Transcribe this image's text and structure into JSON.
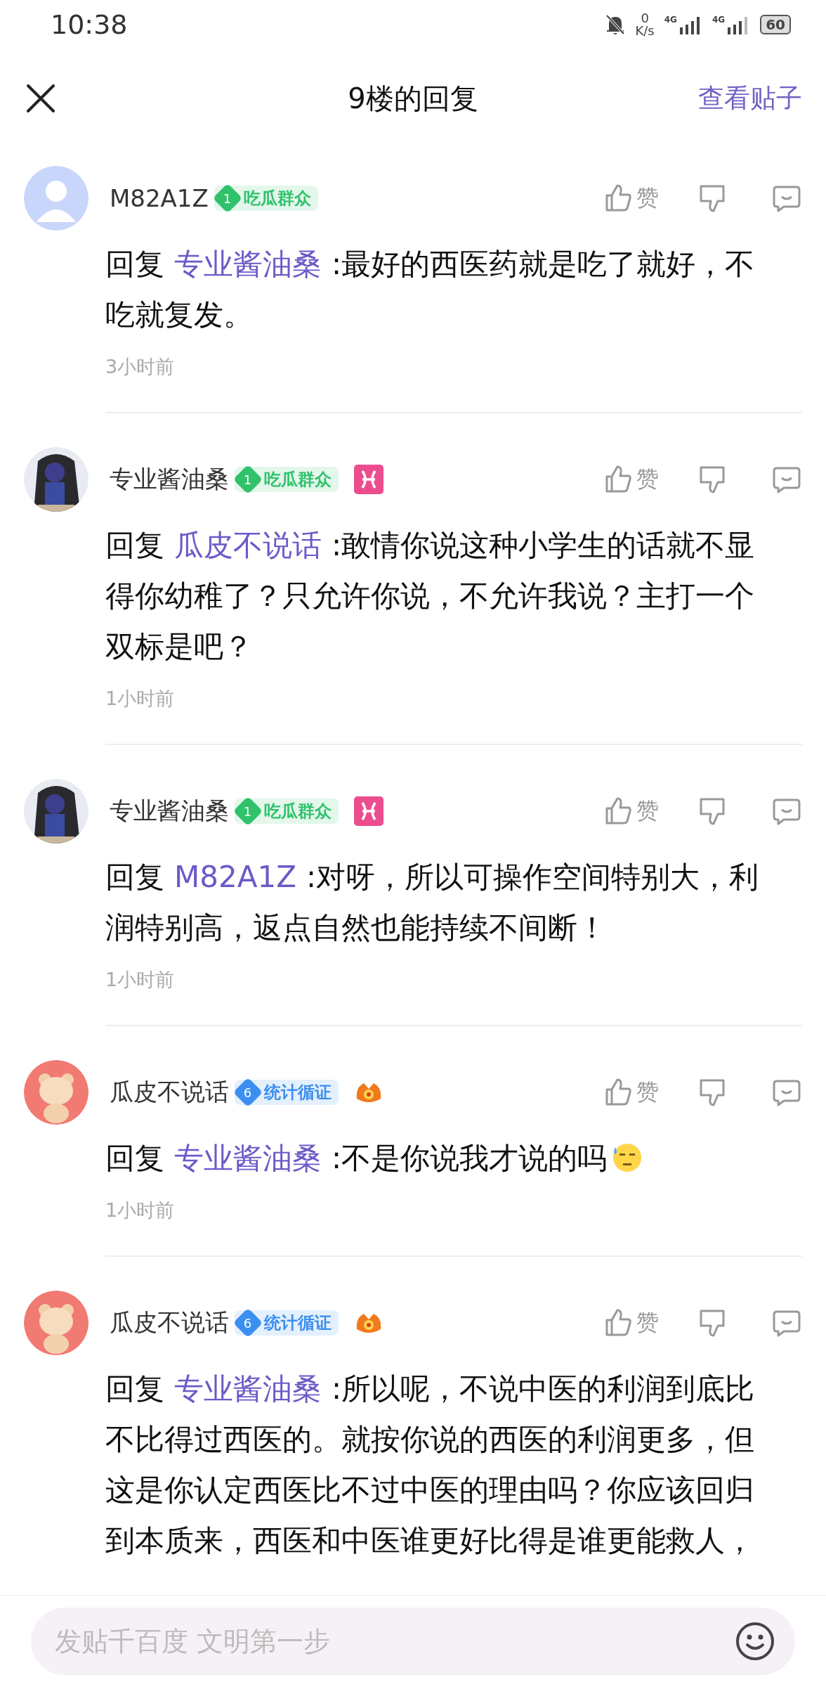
{
  "status_bar": {
    "time": "10:38",
    "net_speed_value": "0",
    "net_speed_unit": "K/s",
    "sim_1": "4G",
    "sim_2": "4G",
    "battery": "60"
  },
  "header": {
    "title": "9楼的回复",
    "action": "查看贴子"
  },
  "comments": [
    {
      "avatar": {
        "kind": "default"
      },
      "name": "M82A1Z",
      "level": "1",
      "badge": "吃瓜群众",
      "color": "#2fc26b",
      "like": "赞",
      "prefix": "回复",
      "reply_to": "专业酱油桑",
      "text": ":最好的西医药就是吃了就好，不吃就复发。",
      "emoji": false,
      "time": "3小时前"
    },
    {
      "avatar": {
        "kind": "anime"
      },
      "name": "专业酱油桑",
      "level": "1",
      "badge": "吃瓜群众",
      "color": "#2fc26b",
      "extra": {
        "kind": "zodiac"
      },
      "like": "赞",
      "prefix": "回复",
      "reply_to": "瓜皮不说话",
      "text": ":敢情你说这种小学生的话就不显得你幼稚了？只允许你说，不允许我说？主打一个双标是吧？",
      "emoji": false,
      "time": "1小时前"
    },
    {
      "avatar": {
        "kind": "anime"
      },
      "name": "专业酱油桑",
      "level": "1",
      "badge": "吃瓜群众",
      "color": "#2fc26b",
      "extra": {
        "kind": "zodiac"
      },
      "like": "赞",
      "prefix": "回复",
      "reply_to": "M82A1Z",
      "text": ":对呀，所以可操作空间特别大，利润特别高，返点自然也能持续不间断！",
      "emoji": false,
      "time": "1小时前"
    },
    {
      "avatar": {
        "kind": "bear"
      },
      "name": "瓜皮不说话",
      "level": "6",
      "badge": "统计循证",
      "color": "#3b8ff0",
      "extra": {
        "kind": "flame"
      },
      "like": "赞",
      "prefix": "回复",
      "reply_to": "专业酱油桑",
      "text": ":不是你说我才说的吗",
      "emoji": true,
      "time": "1小时前"
    },
    {
      "avatar": {
        "kind": "bear"
      },
      "name": "瓜皮不说话",
      "level": "6",
      "badge": "统计循证",
      "color": "#3b8ff0",
      "extra": {
        "kind": "flame"
      },
      "like": "赞",
      "prefix": "回复",
      "reply_to": "专业酱油桑",
      "text": ":所以呢，不说中医的利润到底比不比得过西医的。就按你说的西医的利润更多，但这是你认定西医比不过中医的理由吗？你应该回归到本质来，西医和中医谁更好比得是谁更能救人，",
      "emoji": false
    }
  ],
  "composer": {
    "placeholder": "发贴千百度 文明第一步"
  }
}
